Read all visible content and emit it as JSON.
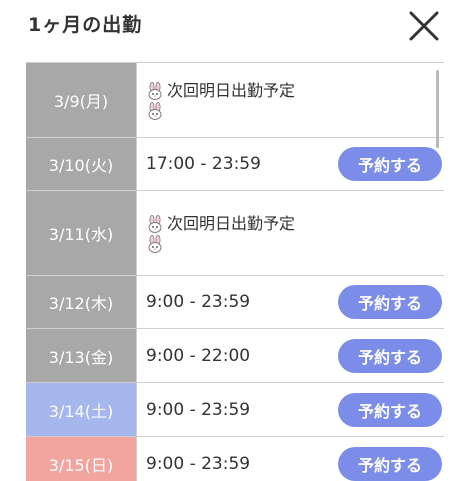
{
  "header": {
    "title": "1ヶ月の出勤"
  },
  "icons": {
    "close": "close-icon",
    "rabbit": "rabbit-icon"
  },
  "colors": {
    "weekday": "#a8a8a8",
    "saturday": "#a6b7ee",
    "sunday": "#f2a59f",
    "button": "#7b8de8"
  },
  "schedule": [
    {
      "date": "3/9(月)",
      "type": "note",
      "note_text": "次回明日出勤予定",
      "day": "weekday"
    },
    {
      "date": "3/10(火)",
      "type": "hours",
      "hours": "17:00 - 23:59",
      "button": "予約する",
      "day": "weekday"
    },
    {
      "date": "3/11(水)",
      "type": "note",
      "note_text": "次回明日出勤予定",
      "day": "weekday"
    },
    {
      "date": "3/12(木)",
      "type": "hours",
      "hours": "9:00 - 23:59",
      "button": "予約する",
      "day": "weekday"
    },
    {
      "date": "3/13(金)",
      "type": "hours",
      "hours": "9:00 - 22:00",
      "button": "予約する",
      "day": "weekday"
    },
    {
      "date": "3/14(土)",
      "type": "hours",
      "hours": "9:00 - 23:59",
      "button": "予約する",
      "day": "saturday"
    },
    {
      "date": "3/15(日)",
      "type": "hours",
      "hours": "9:00 - 23:59",
      "button": "予約する",
      "day": "sunday"
    }
  ]
}
